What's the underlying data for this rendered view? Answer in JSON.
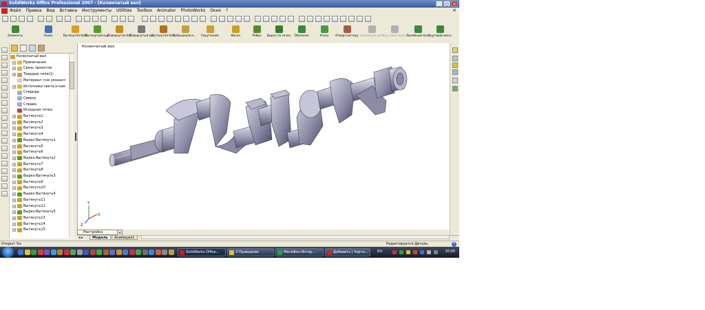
{
  "window": {
    "title": "SolidWorks Office Professional 2007 - [Коленчатый вал]",
    "controls": [
      "_",
      "□",
      "×"
    ]
  },
  "menu": {
    "items": [
      "Файл",
      "Правка",
      "Вид",
      "Вставка",
      "Инструменты",
      "Utilities",
      "Toolbox",
      "Animator",
      "PhotoWorks",
      "Окно",
      "?"
    ],
    "close": "×"
  },
  "command_manager": {
    "groups": [
      {
        "label": "Элементы",
        "color": "#3a8a3a"
      },
      {
        "label": "Эскиз",
        "color": "#4a6fb4"
      }
    ],
    "commands": [
      {
        "label": "Вытянутая бобышка/осн...",
        "color": "#d8a020",
        "enabled": true
      },
      {
        "label": "Вытянутый вырез",
        "color": "#5a9a30",
        "enabled": true
      },
      {
        "label": "Повернутая бобышка/осн...",
        "color": "#c09020",
        "enabled": true
      },
      {
        "label": "Повернутый вырез",
        "color": "#7a7a7a",
        "enabled": true
      },
      {
        "label": "Вытянутая бобышка/Ос...",
        "color": "#b07020",
        "enabled": true
      },
      {
        "label": "Бобышка/осн... по сечениям",
        "color": "#c0a040",
        "enabled": true
      },
      {
        "label": "Скругление",
        "color": "#d0a030",
        "enabled": true
      },
      {
        "label": "Фаска",
        "color": "#c8a020",
        "enabled": true
      },
      {
        "label": "Ребро",
        "color": "#5a8a30",
        "enabled": true
      },
      {
        "label": "Вырез по сечениям",
        "color": "#3a7a30",
        "enabled": true
      },
      {
        "label": "Оболочка",
        "color": "#3a8a3a",
        "enabled": true
      },
      {
        "label": "Уклон",
        "color": "#4a9a3a",
        "enabled": true
      },
      {
        "label": "Отверстие под крепеж",
        "color": "#a06040",
        "enabled": true
      },
      {
        "label": "Линейный массив эскиза",
        "color": "#b0b0b0",
        "enabled": false
      },
      {
        "label": "Круговой массив эскиза",
        "color": "#b0b0b0",
        "enabled": false
      },
      {
        "label": "Линейный массив",
        "color": "#3a8a3a",
        "enabled": true
      },
      {
        "label": "Круговой массив",
        "color": "#3a8a3a",
        "enabled": true
      }
    ]
  },
  "feature_tree": {
    "root": "Коленчатый вал",
    "items": [
      {
        "label": "Примечания",
        "expandable": true,
        "icon_color": "#e0c040"
      },
      {
        "label": "Связь проектов",
        "expandable": true,
        "icon_color": "#e0b050"
      },
      {
        "label": "Твердые тела(1)",
        "expandable": true,
        "icon_color": "#c0a050"
      },
      {
        "label": "Материал <не указан>",
        "expandable": false,
        "icon_color": "#d0d0d0"
      },
      {
        "label": "Источники света и кам",
        "expandable": true,
        "icon_color": "#e0c020"
      },
      {
        "label": "Спереди",
        "expandable": false,
        "icon_color": "#9ab0d0"
      },
      {
        "label": "Сверху",
        "expandable": false,
        "icon_color": "#9ab0d0"
      },
      {
        "label": "Справа",
        "expandable": false,
        "icon_color": "#9ab0d0"
      },
      {
        "label": "Исходная точка",
        "expandable": false,
        "icon_color": "#c04040"
      },
      {
        "label": "Вытянуть1",
        "expandable": true,
        "icon_color": "#d0a020"
      },
      {
        "label": "Вытянуть2",
        "expandable": true,
        "icon_color": "#d0a020"
      },
      {
        "label": "Вытянуть3",
        "expandable": true,
        "icon_color": "#d0a020"
      },
      {
        "label": "Вытянуть4",
        "expandable": true,
        "icon_color": "#d0a020"
      },
      {
        "label": "Вырез-Вытянуть1",
        "expandable": true,
        "icon_color": "#5a9a30"
      },
      {
        "label": "Вытянуть5",
        "expandable": true,
        "icon_color": "#d0a020"
      },
      {
        "label": "Вытянуть6",
        "expandable": true,
        "icon_color": "#d0a020"
      },
      {
        "label": "Вырез-Вытянуть2",
        "expandable": true,
        "icon_color": "#5a9a30"
      },
      {
        "label": "Вытянуть7",
        "expandable": true,
        "icon_color": "#d0a020"
      },
      {
        "label": "Вытянуть8",
        "expandable": true,
        "icon_color": "#d0a020"
      },
      {
        "label": "Вырез-Вытянуть3",
        "expandable": true,
        "icon_color": "#5a9a30"
      },
      {
        "label": "Вытянуть9",
        "expandable": true,
        "icon_color": "#d0a020"
      },
      {
        "label": "Вытянуть10",
        "expandable": true,
        "icon_color": "#d0a020"
      },
      {
        "label": "Вырез-Вытянуть4",
        "expandable": true,
        "icon_color": "#5a9a30"
      },
      {
        "label": "Вытянуть11",
        "expandable": true,
        "icon_color": "#d0a020"
      },
      {
        "label": "Вытянуть12",
        "expandable": true,
        "icon_color": "#d0a020"
      },
      {
        "label": "Вырез-Вытянуть5",
        "expandable": true,
        "icon_color": "#5a9a30"
      },
      {
        "label": "Вытянуть13",
        "expandable": true,
        "icon_color": "#d0a020"
      },
      {
        "label": "Вытянуть14",
        "expandable": true,
        "icon_color": "#d0a020"
      },
      {
        "label": "Вытянуть15",
        "expandable": true,
        "icon_color": "#d0a020"
      }
    ]
  },
  "viewport": {
    "title": "Коленчатый вал",
    "axis_labels": {
      "x": "X",
      "y": "Y",
      "z": "Z"
    }
  },
  "bottom": {
    "config_combo": "Настройка",
    "tabs": [
      "Модель",
      "Анимация1"
    ],
    "nav": "◂ ▸"
  },
  "status": {
    "left": "Открыт %s",
    "right": "Редактируется Деталь",
    "help": "?"
  },
  "taskbar": {
    "tasks": [
      {
        "label": "SolidWorks Office...",
        "icon_color": "#c02020",
        "active": true
      },
      {
        "label": "3 Проводник",
        "icon_color": "#e0c040",
        "active": false
      },
      {
        "label": "МегаФон Интер...",
        "icon_color": "#30a050",
        "active": false
      },
      {
        "label": "Добавить | Черте...",
        "icon_color": "#c03020",
        "active": false
      }
    ],
    "language": "RU",
    "clock": "20:00"
  }
}
